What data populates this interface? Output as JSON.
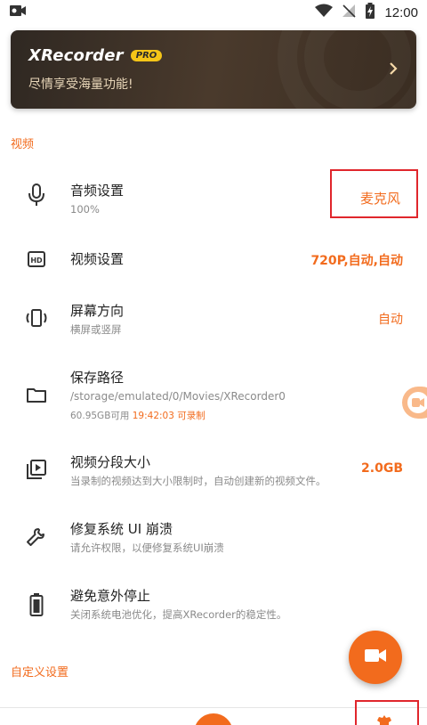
{
  "status_bar": {
    "time": "12:00",
    "icons": [
      "video-camera-icon",
      "wifi-icon",
      "no-signal-icon",
      "battery-charging-icon"
    ]
  },
  "banner": {
    "title": "XRecorder",
    "badge": "PRO",
    "subtitle": "尽情享受海量功能!"
  },
  "sections": {
    "video": "视频",
    "custom": "自定义设置"
  },
  "rows": {
    "audio": {
      "title": "音频设置",
      "subtitle": "100%",
      "value": "麦克风",
      "icon": "microphone-icon"
    },
    "video": {
      "title": "视频设置",
      "value": "720P,自动,自动",
      "icon": "hd-icon"
    },
    "orientation": {
      "title": "屏幕方向",
      "subtitle": "横屏或竖屏",
      "value": "自动",
      "icon": "screen-rotation-icon"
    },
    "storage": {
      "title": "保存路径",
      "path": "/storage/emulated/0/Movies/XRecorder0",
      "available": "60.95GB可用",
      "record_time": "19:42:03 可录制",
      "icon": "folder-icon"
    },
    "segment": {
      "title": "视频分段大小",
      "subtitle": "当录制的视频达到大小限制时，自动创建新的视频文件。",
      "value": "2.0GB",
      "icon": "video-file-icon"
    },
    "fix_ui": {
      "title": "修复系统 UI 崩溃",
      "subtitle": "请允许权限，以便修复系统UI崩溃",
      "icon": "wrench-icon"
    },
    "battery": {
      "title": "避免意外停止",
      "subtitle": "关闭系统电池优化，提高XRecorder的稳定性。",
      "icon": "battery-icon"
    }
  },
  "colors": {
    "accent": "#f26b1d",
    "highlight_box": "#e0262c",
    "banner_bg": "#3a2d22"
  }
}
